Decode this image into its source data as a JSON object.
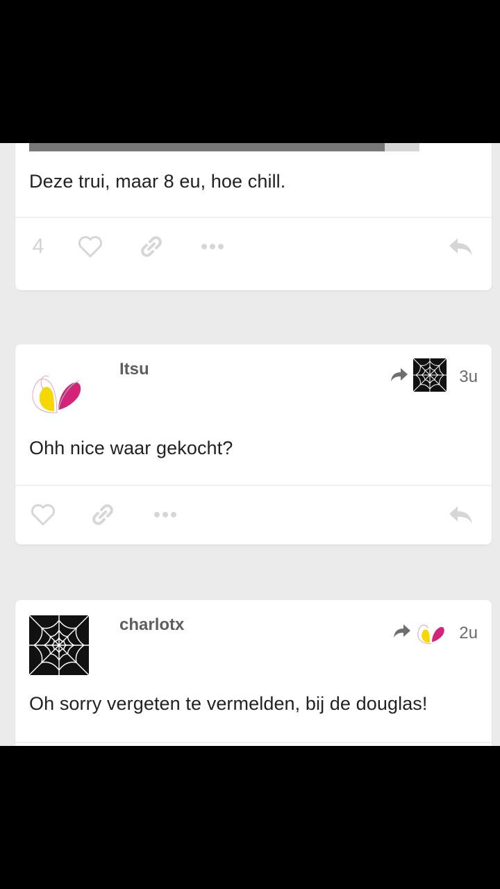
{
  "posts": [
    {
      "text": "Deze trui, maar 8 eu, hoe chill.",
      "like_count": "4"
    },
    {
      "username": "Itsu",
      "time": "3u",
      "avatar_icon": "butterfly-logo-icon",
      "reblog_avatar_icon": "spiderweb-avatar-icon",
      "text": "Ohh nice waar gekocht?"
    },
    {
      "username": "charlotx",
      "time": "2u",
      "avatar_icon": "spiderweb-avatar-icon",
      "reblog_avatar_icon": "butterfly-logo-icon",
      "text": "Oh sorry vergeten te vermelden, bij de douglas!"
    }
  ],
  "colors": {
    "background": "#ebebeb",
    "card": "#ffffff",
    "icon": "#d6d6d6",
    "text": "#222222",
    "butterfly_yellow": "#f5d800",
    "butterfly_magenta": "#d4247a"
  }
}
